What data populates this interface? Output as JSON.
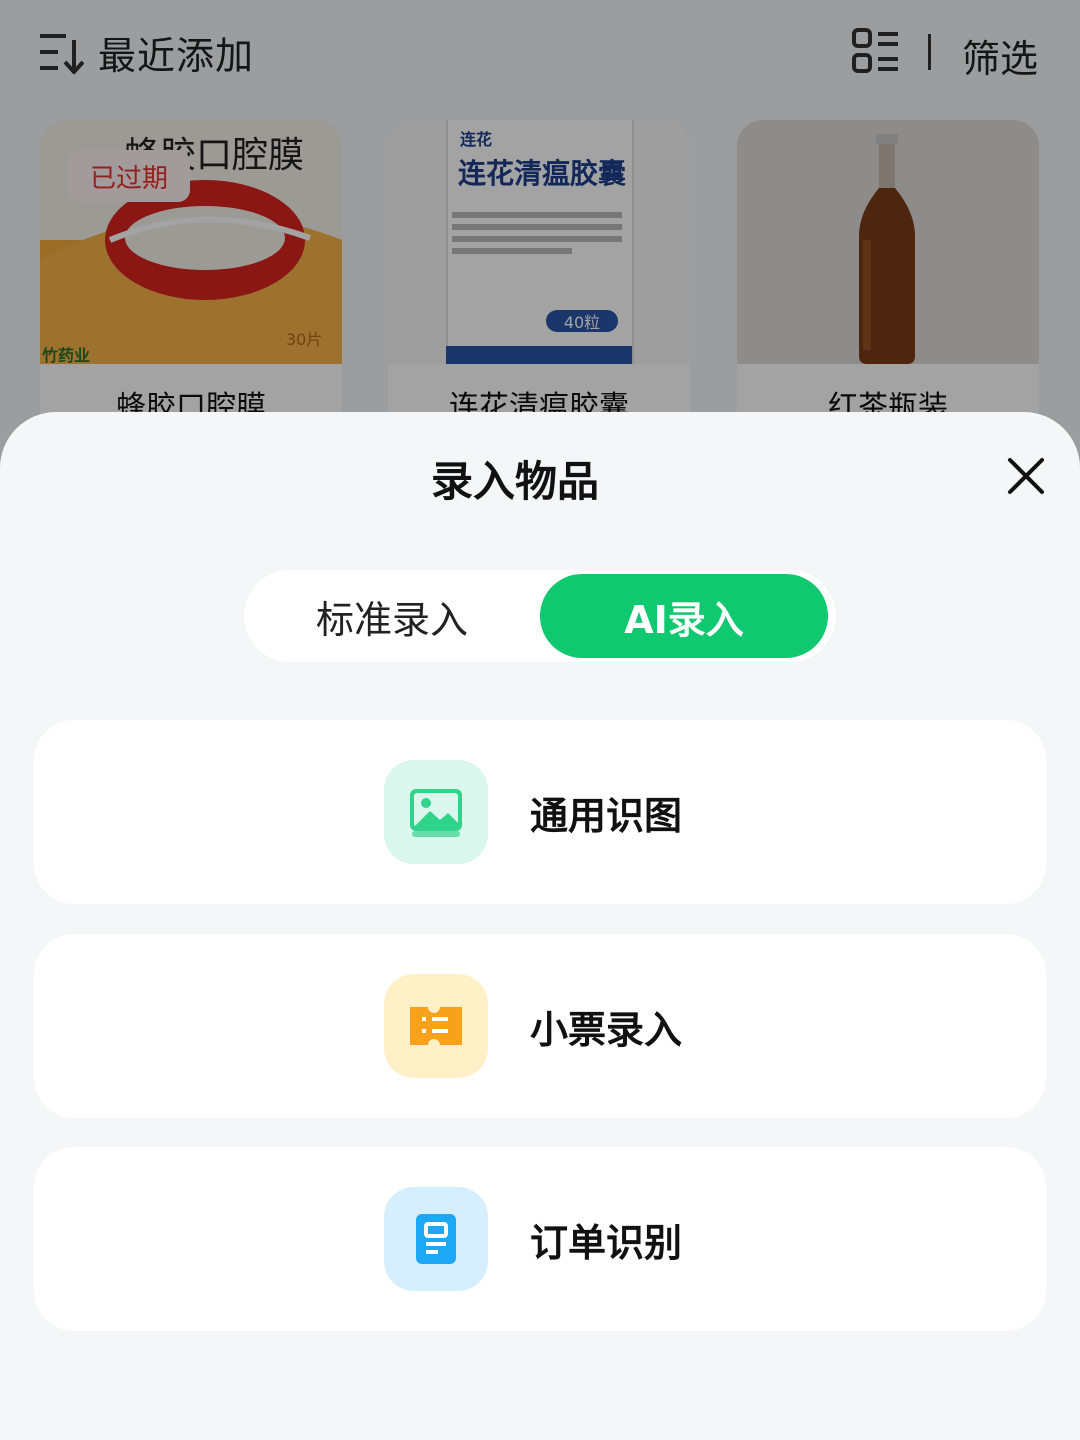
{
  "toolbar": {
    "sort_label": "最近添加",
    "filter_label": "筛选",
    "sort_icon": "sort-descending-icon",
    "view_icon": "list-view-icon"
  },
  "cards": [
    {
      "name": "蜂胶口腔膜",
      "badge": "已过期",
      "box_text": "蜂胶口腔膜",
      "box_pieces": "30片",
      "brand": "竹药业"
    },
    {
      "name": "连花清瘟胶囊",
      "box_text": "连花清瘟胶囊",
      "brand": "连花",
      "count": "40粒"
    },
    {
      "name": "红茶瓶装"
    }
  ],
  "sheet": {
    "title": "录入物品",
    "close_icon": "close-icon",
    "tabs": {
      "standard": "标准录入",
      "ai": "AI录入",
      "active": "ai"
    },
    "options": [
      {
        "label": "通用识图",
        "icon": "image-icon",
        "icon_bg": "#d9f7ec",
        "icon_color": "#19c97f"
      },
      {
        "label": "小票录入",
        "icon": "receipt-icon",
        "icon_bg": "#fff0c8",
        "icon_color": "#f5a623"
      },
      {
        "label": "订单识别",
        "icon": "order-document-icon",
        "icon_bg": "#d6efff",
        "icon_color": "#1ea7f5"
      }
    ]
  },
  "colors": {
    "accent": "#10c86f",
    "expired": "#e8322f"
  }
}
